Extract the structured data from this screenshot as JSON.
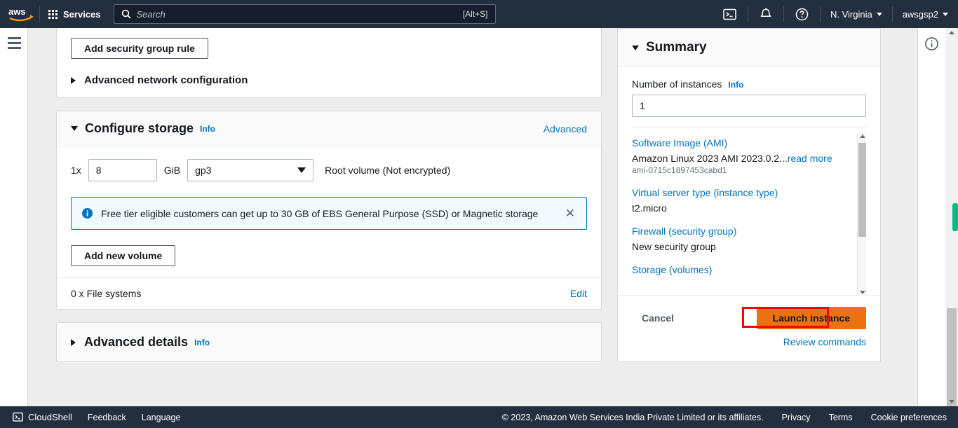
{
  "topnav": {
    "logo": "aws-logo",
    "services_label": "Services",
    "search": {
      "placeholder": "Search",
      "shortcut": "[Alt+S]",
      "icon": "search-icon"
    },
    "cloudshell_icon": "cloudshell-icon",
    "notifications_icon": "bell-icon",
    "help_icon": "question-circle-icon",
    "region": "N. Virginia",
    "account": "awsgsp2"
  },
  "network_card": {
    "add_rule_label": "Add security group rule",
    "advanced_network_label": "Advanced network configuration"
  },
  "storage_card": {
    "title": "Configure storage",
    "info_label": "Info",
    "advanced_label": "Advanced",
    "volume": {
      "count_label": "1x",
      "size_value": "8",
      "unit_label": "GiB",
      "type_value": "gp3",
      "description": "Root volume  (Not encrypted)"
    },
    "alert": {
      "icon": "info-circle-icon",
      "message": "Free tier eligible customers can get up to 30 GB of EBS General Purpose (SSD) or Magnetic storage",
      "close_icon": "close-icon"
    },
    "add_volume_label": "Add new volume",
    "filesystems_label": "0 x File systems",
    "edit_label": "Edit"
  },
  "advanced_details_card": {
    "title": "Advanced details",
    "info_label": "Info"
  },
  "summary": {
    "title": "Summary",
    "number_of_instances_label": "Number of instances",
    "info_label": "Info",
    "number_of_instances_value": "1",
    "items": [
      {
        "link": "Software Image (AMI)",
        "value": "Amazon Linux 2023 AMI 2023.0.2...",
        "read_more": "read more",
        "sub": "ami-0715c1897453cabd1"
      },
      {
        "link": "Virtual server type (instance type)",
        "value": "t2.micro",
        "read_more": "",
        "sub": ""
      },
      {
        "link": "Firewall (security group)",
        "value": "New security group",
        "read_more": "",
        "sub": ""
      },
      {
        "link": "Storage (volumes)",
        "value": "",
        "read_more": "",
        "sub": ""
      }
    ],
    "cancel_label": "Cancel",
    "launch_label": "Launch instance",
    "review_label": "Review commands"
  },
  "right_rail": {
    "info_icon": "info-circle-icon"
  },
  "footer": {
    "cloudshell": "CloudShell",
    "feedback": "Feedback",
    "language": "Language",
    "copyright": "© 2023, Amazon Web Services India Private Limited or its affiliates.",
    "privacy": "Privacy",
    "terms": "Terms",
    "cookies": "Cookie preferences"
  },
  "colors": {
    "nav_bg": "#232f3e",
    "link": "#0073bb",
    "launch_orange": "#ec7211",
    "annotation_red": "#ff0000",
    "page_bg": "#ededed"
  }
}
